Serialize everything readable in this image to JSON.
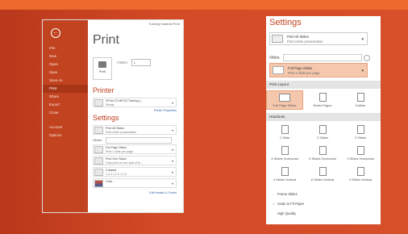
{
  "left_screen": {
    "title_bar_text": "Training material Print",
    "back_icon": "back-arrow-icon",
    "nav": [
      "Info",
      "New",
      "Open",
      "Save",
      "Save As",
      "Print",
      "Share",
      "Export",
      "Close",
      "Account",
      "Options"
    ],
    "active_nav": "Print",
    "heading": "Print",
    "print_button_label": "Print",
    "copies_label": "Copies:",
    "copies_value": "1",
    "printer_heading": "Printer",
    "printer_name": "VPrint C3 MR ECTraining (...",
    "printer_status": "Ready",
    "printer_properties_link": "Printer Properties",
    "settings_heading": "Settings",
    "setting_print_all": {
      "title": "Print All Slides",
      "subtitle": "Print entire presentation"
    },
    "slides_label": "Slides:",
    "setting_layout": {
      "title": "Full Page Slides",
      "subtitle": "Print 1 slide per page"
    },
    "setting_sides": {
      "title": "Print One Sided",
      "subtitle": "Only print on one side of th..."
    },
    "setting_collated": {
      "title": "Collated",
      "subtitle": "1,2,3   1,2,3   1,2,3"
    },
    "setting_color": {
      "title": "Color",
      "subtitle": ""
    },
    "edit_link": "Edit Header & Footer"
  },
  "right_screen": {
    "settings_heading": "Settings",
    "print_all": {
      "title": "Print All Slides",
      "subtitle": "Print entire presentation"
    },
    "slides_label": "Slides:",
    "selected_layout": {
      "title": "Full Page Slides",
      "subtitle": "Print 1 slide per page"
    },
    "print_layout_header": "Print Layout",
    "layout_options": [
      "Full Page Slides",
      "Notes Pages",
      "Outline"
    ],
    "handouts_header": "Handouts",
    "handouts": [
      "1 Slide",
      "2 Slides",
      "3 Slides",
      "4 Slides Horizontal",
      "6 Slides Horizontal",
      "9 Slides Horizontal",
      "4 Slides Vertical",
      "6 Slides Vertical",
      "9 Slides Vertical"
    ],
    "frame_slides": "Frame Slides",
    "scale_to_fit": "Scale to Fit Paper",
    "high_quality": "High Quality"
  },
  "colors": {
    "accent": "#c1431f",
    "background": "#d24a26",
    "highlight": "#f5c8ad"
  }
}
